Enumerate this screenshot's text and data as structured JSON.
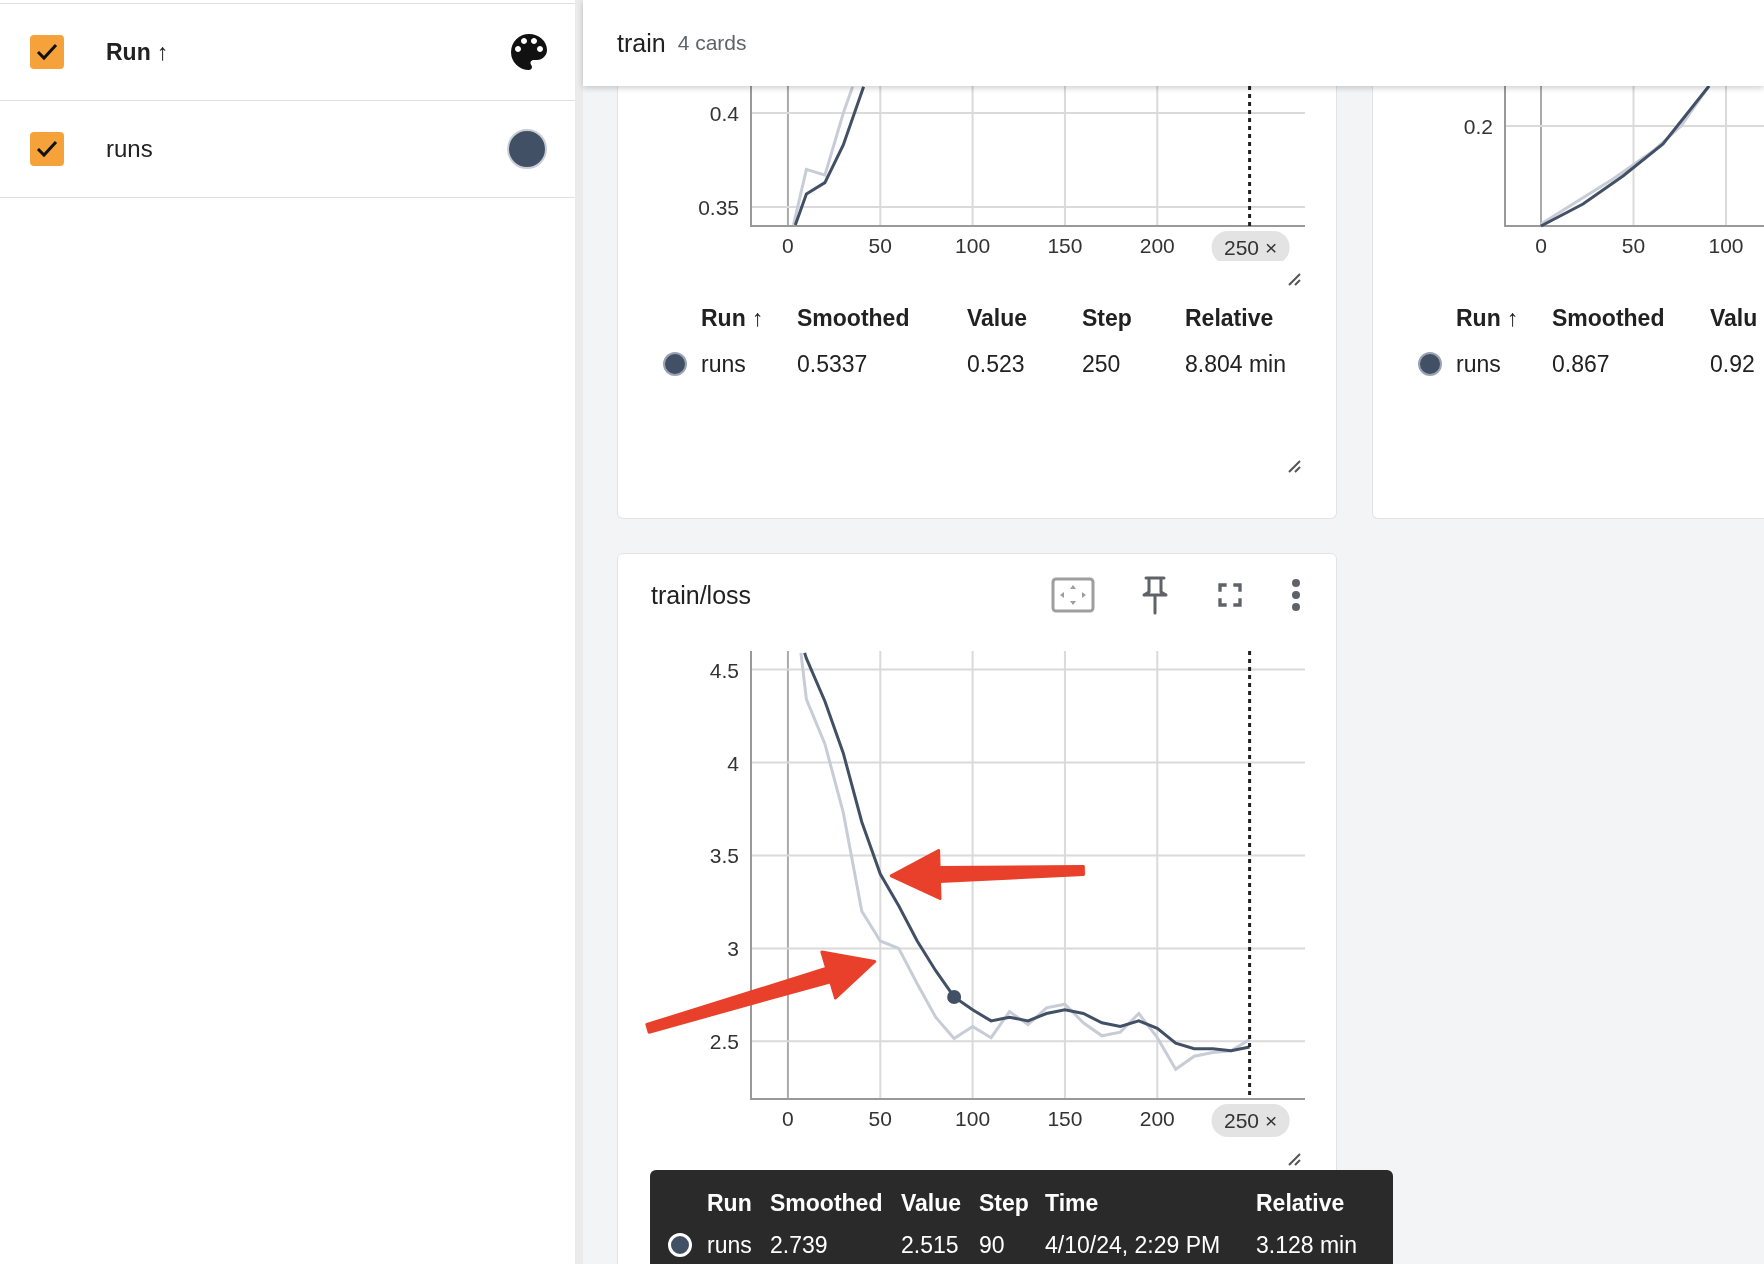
{
  "sidebar": {
    "header": {
      "label": "Run ↑",
      "checked": true
    },
    "runs": [
      {
        "label": "runs",
        "checked": true,
        "color": "#425066"
      }
    ]
  },
  "group": {
    "title": "train",
    "count": "4 cards"
  },
  "cards": [
    {
      "kind": "chart",
      "chart_data": {
        "type": "line",
        "grid": true,
        "x": [
          3,
          4,
          10,
          20,
          30,
          35,
          41
        ],
        "series": [
          {
            "color": "#c7ccd6",
            "values": [
              0.3405,
              null,
              0.37,
              0.367,
              0.4,
              0.414,
              null
            ]
          },
          {
            "color": "#425066",
            "values": [
              null,
              0.3405,
              0.357,
              0.363,
              0.383,
              null,
              0.414
            ]
          }
        ],
        "xlim": [
          -20,
          280
        ],
        "ylim": [
          0.3399,
          0.4144
        ],
        "xticks": [
          0,
          50,
          100,
          150,
          200,
          {
            "value": 250,
            "label": "250 ×"
          }
        ],
        "yticks": [
          0.35,
          0.4
        ],
        "ref_lines": [
          {
            "axis": "x",
            "value": 250
          }
        ]
      },
      "table": {
        "columns": [
          "Run ↑",
          "Smoothed",
          "Value",
          "Step",
          "Relative"
        ],
        "rows": [
          {
            "color": "#425066",
            "cells": [
              "runs",
              "0.5337",
              "0.523",
              "250",
              "8.804 min"
            ]
          }
        ]
      }
    },
    {
      "kind": "sketch",
      "y_ticks": [
        "0.2"
      ],
      "x_ticks": [
        "0",
        "50",
        "100"
      ],
      "table": {
        "columns": [
          "Run ↑",
          "Smoothed",
          "Valu"
        ],
        "rows": [
          {
            "color": "#425066",
            "cells": [
              "runs",
              "0.867",
              "0.92"
            ]
          }
        ]
      }
    },
    {
      "kind": "chart",
      "title": "train/loss",
      "chart_data": {
        "type": "line",
        "grid": true,
        "x": [
          7,
          9,
          10,
          20,
          30,
          40,
          50,
          60,
          70,
          80,
          90,
          100,
          110,
          120,
          130,
          140,
          150,
          160,
          170,
          180,
          190,
          200,
          210,
          220,
          230,
          240,
          250
        ],
        "series": [
          {
            "color": "#c7ccd6",
            "values": [
              4.59,
              null,
              4.34,
              4.1,
              3.73,
              3.2,
              3.04,
              3.0,
              2.81,
              2.63,
              2.515,
              2.58,
              2.52,
              2.66,
              2.59,
              2.68,
              2.7,
              2.6,
              2.53,
              2.55,
              2.65,
              2.52,
              2.35,
              2.42,
              2.44,
              2.45,
              2.51
            ]
          },
          {
            "color": "#425066",
            "values": [
              null,
              4.59,
              4.56,
              4.33,
              4.05,
              3.68,
              3.4,
              3.23,
              3.04,
              2.88,
              2.739,
              2.67,
              2.61,
              2.63,
              2.61,
              2.65,
              2.67,
              2.65,
              2.6,
              2.58,
              2.61,
              2.57,
              2.49,
              2.46,
              2.46,
              2.45,
              2.47
            ]
          }
        ],
        "xlim": [
          -20,
          280
        ],
        "ylim": [
          2.19,
          4.6
        ],
        "xticks": [
          0,
          50,
          100,
          150,
          200,
          {
            "value": 250,
            "label": "250 ×"
          }
        ],
        "yticks": [
          2.5,
          3,
          3.5,
          4,
          4.5
        ],
        "ref_lines": [
          {
            "axis": "x",
            "value": 250
          }
        ]
      },
      "hover_point_shown": true,
      "tooltip": {
        "columns": [
          "Run",
          "Smoothed",
          "Value",
          "Step",
          "Time",
          "Relative"
        ],
        "rows": [
          {
            "color": "#425066",
            "cells": [
              "runs",
              "2.739",
              "2.515",
              "90",
              "4/10/24, 2:29 PM",
              "3.128 min"
            ]
          }
        ]
      }
    }
  ]
}
